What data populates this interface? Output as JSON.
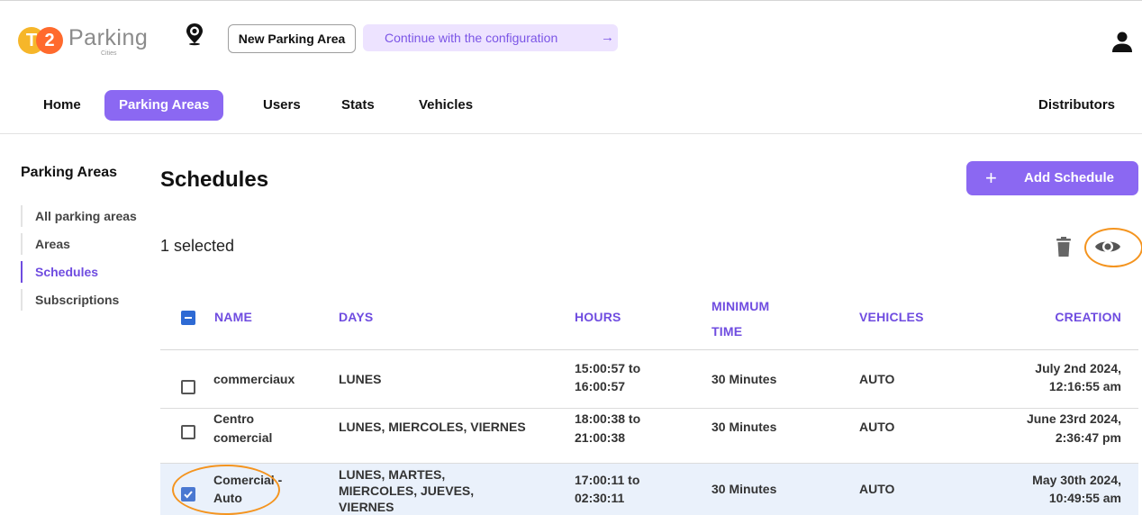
{
  "header": {
    "logo_t": "T",
    "logo_2": "2",
    "brand": "Parking",
    "brand_sub": "Cities",
    "new_area_label": "New Parking Area",
    "config_label": "Continue with the configuration",
    "config_arrow": "→"
  },
  "nav": {
    "items": [
      {
        "label": "Home"
      },
      {
        "label": "Parking Areas"
      },
      {
        "label": "Users"
      },
      {
        "label": "Stats"
      },
      {
        "label": "Vehicles"
      }
    ],
    "right_label": "Distributors"
  },
  "sidebar": {
    "title": "Parking Areas",
    "items": [
      {
        "label": "All parking areas"
      },
      {
        "label": "Areas"
      },
      {
        "label": "Schedules"
      },
      {
        "label": "Subscriptions"
      }
    ]
  },
  "main": {
    "title": "Schedules",
    "add_button": "Add Schedule",
    "add_plus": "+",
    "selected_text": "1 selected"
  },
  "table": {
    "headers": {
      "name": "NAME",
      "days": "DAYS",
      "hours": "HOURS",
      "minimum_time_1": "MINIMUM",
      "minimum_time_2": "TIME",
      "vehicles": "VEHICLES",
      "creation": "CREATION"
    },
    "rows": [
      {
        "name_1": "commerciaux",
        "name_2": "",
        "days_1": "LUNES",
        "days_2": "",
        "days_3": "",
        "hours_1": "15:00:57 to",
        "hours_2": "16:00:57",
        "min_time": "30 Minutes",
        "vehicles": "AUTO",
        "creation_1": "July 2nd 2024,",
        "creation_2": "12:16:55 am",
        "checked": false
      },
      {
        "name_1": "Centro",
        "name_2": "comercial",
        "days_1": "LUNES, MIERCOLES, VIERNES",
        "days_2": "",
        "days_3": "",
        "hours_1": "18:00:38 to",
        "hours_2": "21:00:38",
        "min_time": "30 Minutes",
        "vehicles": "AUTO",
        "creation_1": "June 23rd 2024,",
        "creation_2": "2:36:47 pm",
        "checked": false
      },
      {
        "name_1": "Comercial -",
        "name_2": "Auto",
        "days_1": "LUNES, MARTES,",
        "days_2": "MIERCOLES, JUEVES,",
        "days_3": "VIERNES",
        "hours_1": "17:00:11 to",
        "hours_2": "02:30:11",
        "min_time": "30 Minutes",
        "vehicles": "AUTO",
        "creation_1": "May 30th 2024,",
        "creation_2": "10:49:55 am",
        "checked": true
      }
    ]
  },
  "colors": {
    "accent": "#8b68f2",
    "accent_text": "#6f4ce0",
    "annotation": "#f4941f",
    "selected_row": "#eaf1fb"
  }
}
